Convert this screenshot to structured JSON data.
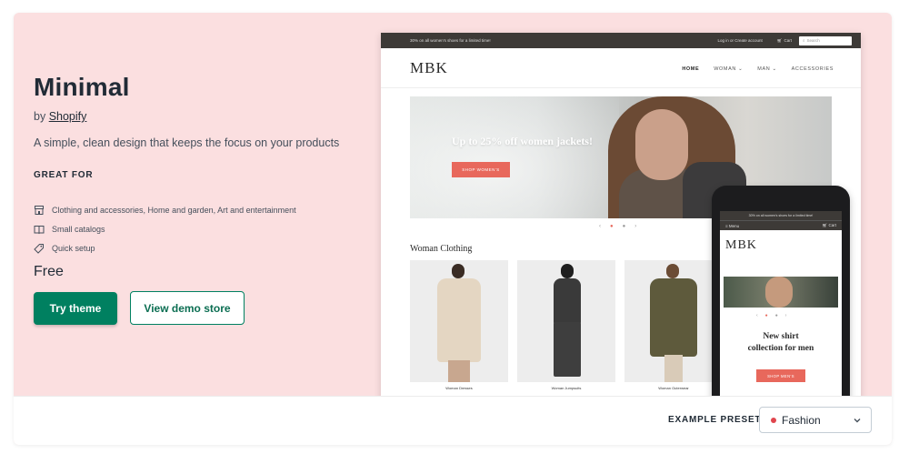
{
  "theme": {
    "title": "Minimal",
    "by_prefix": "by",
    "author": "Shopify",
    "description": "A simple, clean design that keeps the focus on your products",
    "great_for_heading": "GREAT FOR",
    "features": [
      {
        "icon": "store-icon",
        "label": "Clothing and accessories, Home and garden, Art and entertainment"
      },
      {
        "icon": "book-icon",
        "label": "Small catalogs"
      },
      {
        "icon": "tag-icon",
        "label": "Quick setup"
      }
    ],
    "price": "Free",
    "try_label": "Try theme",
    "demo_label": "View demo store"
  },
  "desktop_preview": {
    "promo": "30% on all women's shoes for a limited time!",
    "account_links": "Log in  or  Create account",
    "cart": "Cart",
    "search_placeholder": "Search",
    "logo": "MBK",
    "nav": [
      "HOME",
      "WOMAN ⌄",
      "MAN ⌄",
      "ACCESSORIES"
    ],
    "hero_text": "Up to 25% off women jackets!",
    "hero_button": "SHOP WOMEN'S",
    "section_title": "Woman Clothing",
    "products": [
      "Woman Dresses",
      "Woman Jumpsuits",
      "Woman Outerwear"
    ]
  },
  "mobile_preview": {
    "promo": "30% on all women's shoes for a limited time!",
    "menu": "Menu",
    "cart": "Cart",
    "logo": "MBK",
    "hero_text_line1": "New shirt",
    "hero_text_line2": "collection for men",
    "hero_button": "SHOP MEN'S"
  },
  "presets": {
    "label": "EXAMPLE PRESETS",
    "selected": "Fashion",
    "selected_color": "#e0464d"
  },
  "colors": {
    "background": "#fbdfe0",
    "primary": "#008060",
    "accent": "#e8685c"
  }
}
